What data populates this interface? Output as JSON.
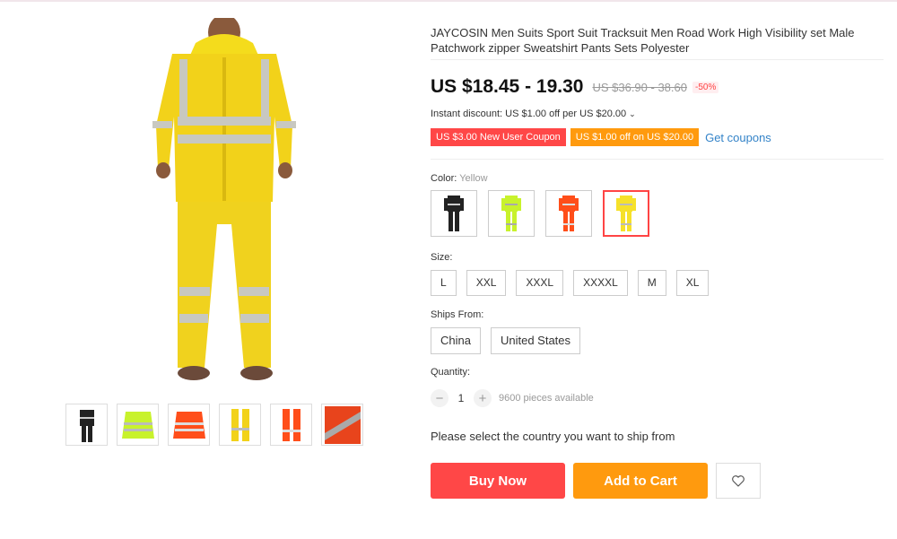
{
  "product": {
    "title": "JAYCOSIN Men Suits Sport Suit Tracksuit Men Road Work High Visibility set Male Patchwork zipper Sweatshirt Pants Sets Polyester",
    "price": "US $18.45 - 19.30",
    "original_price": "US $36.90 - 38.60",
    "discount": "-50%",
    "instant_discount": "Instant discount: US $1.00 off per US $20.00",
    "coupons": [
      {
        "label": "US $3.00 New User Coupon"
      },
      {
        "label": "US $1.00 off on US $20.00"
      }
    ],
    "get_coupons": "Get coupons"
  },
  "color": {
    "label": "Color:",
    "selected": "Yellow",
    "options": [
      {
        "name": "Black"
      },
      {
        "name": "Green"
      },
      {
        "name": "Orange"
      },
      {
        "name": "Yellow"
      }
    ],
    "colors": {
      "black": "#222222",
      "green": "#c8f22c",
      "orange": "#ff4e1a",
      "yellow": "#f6e12a"
    }
  },
  "size": {
    "label": "Size:",
    "options": [
      "L",
      "XXL",
      "XXXL",
      "XXXXL",
      "M",
      "XL"
    ]
  },
  "ships_from": {
    "label": "Ships From:",
    "options": [
      "China",
      "United States"
    ]
  },
  "quantity": {
    "label": "Quantity:",
    "value": "1",
    "available": "9600 pieces available",
    "minus": "−",
    "plus": "+"
  },
  "ship_message": "Please select the country you want to ship from",
  "actions": {
    "buy_now": "Buy Now",
    "add_to_cart": "Add to Cart",
    "wishlist_icon": "heart-icon"
  },
  "theme": {
    "accent_red": "#ff4747",
    "accent_orange": "#ff9a0e",
    "link_blue": "#3383c8"
  }
}
